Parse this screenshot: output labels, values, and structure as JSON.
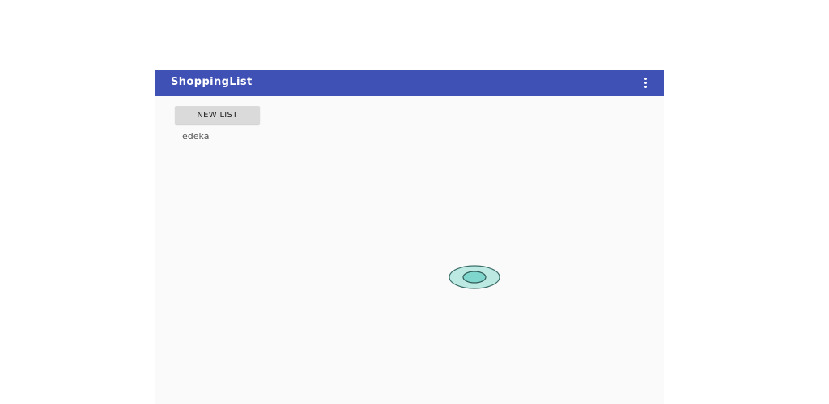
{
  "appbar": {
    "title": "ShoppingList",
    "overflow_icon": "more-vert-icon",
    "background": "#3f51b5"
  },
  "main": {
    "new_list_label": "NEW LIST",
    "lists": [
      {
        "name": "edeka"
      }
    ]
  },
  "colors": {
    "content_background": "#fafafa",
    "touch_indicator": "#7fd6cc"
  }
}
